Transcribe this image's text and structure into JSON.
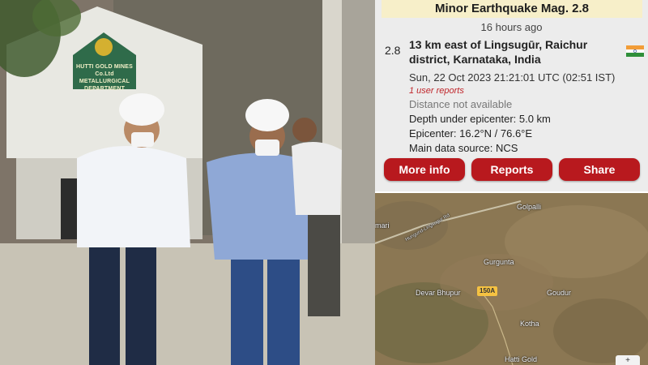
{
  "photo": {
    "sign_text": "HUTTI GOLD MINES Co.Ltd METALLURGICAL DEPARTMENT"
  },
  "quake": {
    "title": "Minor Earthquake Mag. 2.8",
    "time_ago": "16 hours ago",
    "magnitude": "2.8",
    "location": "13 km east of Lingsugūr, Raichur district, Karnataka, India",
    "datetime": "Sun, 22 Oct 2023 21:21:01 UTC (02:51 IST)",
    "user_reports": "1 user reports",
    "distance": "Distance not available",
    "depth": "Depth under epicenter: 5.0 km",
    "epicenter": "Epicenter: 16.2°N / 76.6°E",
    "source": "Main data source: NCS",
    "flag_icon": "india-flag-icon"
  },
  "buttons": {
    "more_info": "More info",
    "reports": "Reports",
    "share": "Share"
  },
  "map": {
    "labels": {
      "golpalli": "Golpalli",
      "mari": "mari",
      "road": "Hungund-Lingsugur Rd",
      "gurgunta": "Gurgunta",
      "devar_bhupur": "Devar Bhupur",
      "route": "150A",
      "goudur": "Goudur",
      "kotha": "Kotha",
      "hatti_gold": "Hatti Gold"
    },
    "control_symbol": "+"
  },
  "colors": {
    "button_red": "#b8191e",
    "title_band": "#f7efc9",
    "reports_text": "#c0262b"
  }
}
